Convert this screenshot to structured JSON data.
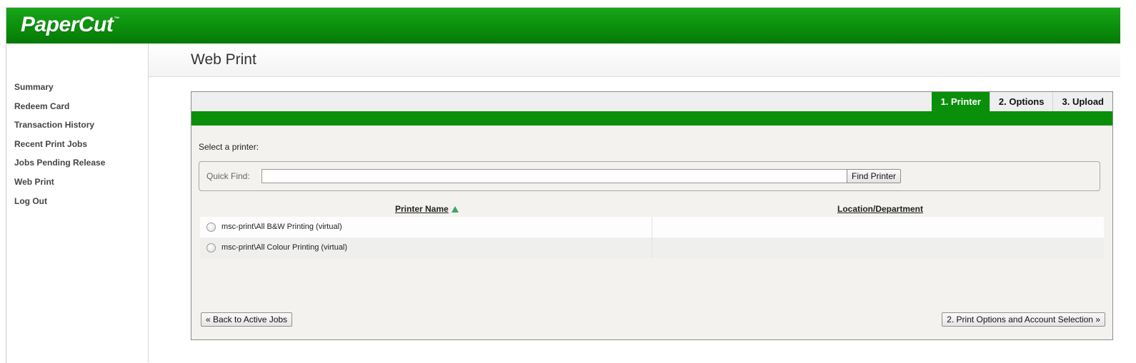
{
  "header": {
    "logo_text": "PaperCut",
    "logo_tm": "™",
    "color": "#0a8f0a"
  },
  "sidebar": {
    "items": [
      {
        "label": "Summary"
      },
      {
        "label": "Redeem Card"
      },
      {
        "label": "Transaction History"
      },
      {
        "label": "Recent Print Jobs"
      },
      {
        "label": "Jobs Pending Release"
      },
      {
        "label": "Web Print"
      },
      {
        "label": "Log Out"
      }
    ]
  },
  "page": {
    "title": "Web Print"
  },
  "wizard": {
    "tabs": [
      {
        "label": "1. Printer",
        "active": true
      },
      {
        "label": "2. Options",
        "active": false
      },
      {
        "label": "3. Upload",
        "active": false
      }
    ],
    "select_label": "Select a printer:",
    "quick_find": {
      "label": "Quick Find:",
      "value": "",
      "placeholder": "",
      "button": "Find Printer"
    },
    "table": {
      "columns": [
        "Printer Name",
        "Location/Department"
      ],
      "sort_icon": "sort-ascending-icon",
      "rows": [
        {
          "name": "msc-print\\All B&W Printing (virtual)",
          "location": ""
        },
        {
          "name": "msc-print\\All Colour Printing (virtual)",
          "location": ""
        }
      ]
    },
    "back_button": "« Back to Active Jobs",
    "next_button": "2. Print Options and Account Selection »"
  }
}
